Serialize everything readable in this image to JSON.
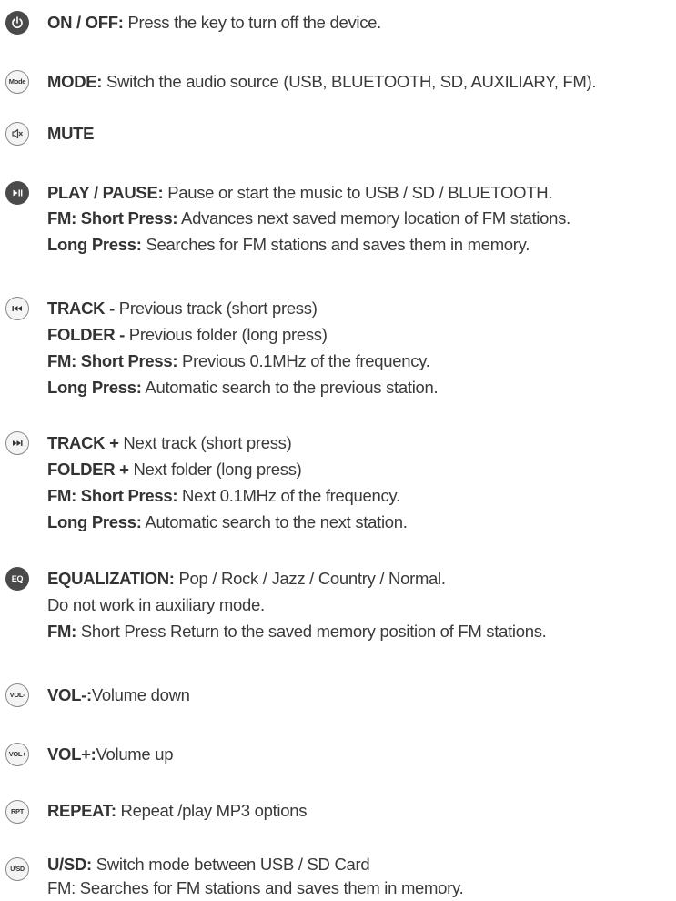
{
  "entries": [
    {
      "icon": "power-icon",
      "label": "",
      "lines": [
        {
          "bold": "ON / OFF:",
          "text": " Press the key to turn off the device."
        }
      ]
    },
    {
      "icon": "mode-icon",
      "label": "Mode",
      "lines": [
        {
          "bold": "MODE:",
          "text": " Switch the audio source (USB, BLUETOOTH, SD, AUXILIARY, FM)."
        }
      ]
    },
    {
      "icon": "mute-icon",
      "label": "",
      "lines": [
        {
          "bold": "MUTE",
          "text": ""
        }
      ]
    },
    {
      "icon": "play-pause-icon",
      "label": "",
      "lines": [
        {
          "bold": "PLAY / PAUSE:",
          "text": " Pause or start the music to  USB / SD / BLUETOOTH."
        },
        {
          "bold": "FM: Short Press:",
          "text": " Advances next saved memory location of FM stations."
        },
        {
          "bold": "Long Press:",
          "text": " Searches for FM stations and saves them in memory."
        }
      ]
    },
    {
      "icon": "previous-track-icon",
      "label": "",
      "lines": [
        {
          "bold": "TRACK -",
          "text": "  Previous  track (short press)"
        },
        {
          "bold": "FOLDER -",
          "text": "  Previous folder (long press)"
        },
        {
          "bold": "FM: Short Press:",
          "text": " Previous 0.1MHz of the frequency."
        },
        {
          "bold": "Long Press:",
          "text": " Automatic search to the previous station."
        }
      ]
    },
    {
      "icon": "next-track-icon",
      "label": "",
      "lines": [
        {
          "bold": "TRACK +",
          "text": " Next track (short press)"
        },
        {
          "bold": "FOLDER +",
          "text": " Next folder (long press)"
        },
        {
          "bold": "FM: Short Press:",
          "text": " Next 0.1MHz of the frequency."
        },
        {
          "bold": "Long Press:",
          "text": " Automatic search to the next station."
        }
      ]
    },
    {
      "icon": "eq-icon",
      "label": "EQ",
      "lines": [
        {
          "bold": "EQUALIZATION:",
          "text": " Pop / Rock / Jazz / Country / Normal."
        },
        {
          "bold": "",
          "text": "Do not work in auxiliary mode."
        },
        {
          "bold": "FM:",
          "text": " Short Press Return to the saved memory position of FM stations."
        }
      ]
    },
    {
      "icon": "vol-down-icon",
      "label": "VOL-",
      "lines": [
        {
          "bold": "VOL-:",
          "text": "Volume down"
        }
      ]
    },
    {
      "icon": "vol-up-icon",
      "label": "VOL+",
      "lines": [
        {
          "bold": "VOL+:",
          "text": "Volume up"
        }
      ]
    },
    {
      "icon": "repeat-icon",
      "label": "RPT",
      "lines": [
        {
          "bold": "REPEAT:",
          "text": " Repeat /play MP3 options"
        }
      ]
    },
    {
      "icon": "usb-sd-icon",
      "label": "U/SD",
      "lines": [
        {
          "bold": "U/SD:",
          "text": " Switch mode between USB / SD Card"
        },
        {
          "bold": "",
          "text": "FM: Searches for FM stations and saves them in memory."
        }
      ]
    }
  ]
}
